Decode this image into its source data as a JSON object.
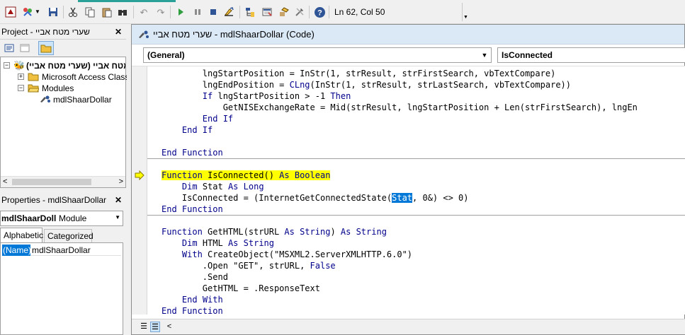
{
  "toolbar": {
    "icons": [
      "access-key-icon",
      "insert-tools-icon",
      "dropdown-arrow-icon",
      "save-icon",
      "cut-icon",
      "copy-icon",
      "paste-icon",
      "find-icon",
      "undo-icon",
      "redo-icon",
      "run-icon",
      "break-icon",
      "reset-icon",
      "design-mode-icon",
      "project-explorer-icon",
      "properties-icon",
      "object-browser-icon",
      "toolbox-icon",
      "help-icon"
    ],
    "position": "Ln 62, Col 50"
  },
  "project_panel": {
    "title": "Project - שערי מטח אביי",
    "tree": {
      "project": "שערי מטח אביי (שערי מטח אביי)",
      "ms_access_class": "Microsoft Access Class O",
      "modules": "Modules",
      "module_item": "mdlShaarDollar"
    }
  },
  "properties_panel": {
    "title": "Properties - mdlShaarDollar",
    "object_name": "mdlShaarDoll",
    "object_type": "Module",
    "tabs": [
      "Alphabetic",
      "Categorized"
    ],
    "property_name": "(Name)",
    "property_value": "mdlShaarDollar"
  },
  "code_window": {
    "title": "שערי מטח אביי - mdlShaarDollar (Code)",
    "object_combo": "(General)",
    "proc_combo": "IsConnected",
    "lines": {
      "l1_indent": "        ",
      "l1_a": "lngStartPosition = InStr(1, strResult, strFirstSearch, vbTextCompare)",
      "l2_indent": "        ",
      "l2_a": "lngEndPosition = ",
      "l2_kw": "CLng",
      "l2_b": "(InStr(1, strResult, strLastSearch, vbTextCompare))",
      "l3_kw1": "If",
      "l3_a": " lngStartPosition > -1 ",
      "l3_kw2": "Then",
      "l4": "GetNISExchangeRate = Mid(strResult, lngStartPosition + Len(strFirstSearch), lngEn",
      "l5": "End If",
      "l6": "End If",
      "l7": "End Function",
      "f2_line1_kw1": "Function",
      "f2_line1_a": " IsConnected() ",
      "f2_line1_kw2": "As",
      "f2_line1_kw3": "Boolean",
      "f2_line2_kw1": "Dim",
      "f2_line2_a": " Stat ",
      "f2_line2_kw2": "As",
      "f2_line2_kw3": "Long",
      "f2_line3_a": "IsConnected = (InternetGetConnectedState(",
      "f2_line3_sel": "Stat",
      "f2_line3_b": ", 0&) <> 0)",
      "f2_line4": "End Function",
      "f3_line1_kw1": "Function",
      "f3_line1_a": " GetHTML(strURL ",
      "f3_line1_kw2": "As",
      "f3_line1_kw3": "String",
      "f3_line1_b": ") ",
      "f3_line1_kw4": "As",
      "f3_line1_kw5": "String",
      "f3_line2_kw1": "Dim",
      "f3_line2_a": " HTML ",
      "f3_line2_kw2": "As",
      "f3_line2_kw3": "String",
      "f3_line3_kw1": "With",
      "f3_line3_a": " CreateObject(\"MSXML2.ServerXMLHTTP.6.0\")",
      "f3_line4_a": ".Open \"GET\", strURL, ",
      "f3_line4_kw": "False",
      "f3_line5": ".Send",
      "f3_line6": "GetHTML = .ResponseText",
      "f3_line7_kw1": "End",
      "f3_line7_kw2": "With",
      "f3_line8": "End Function"
    }
  }
}
